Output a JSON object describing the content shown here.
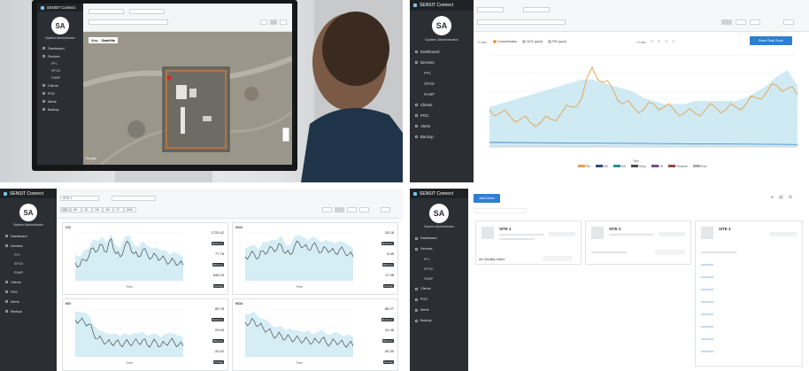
{
  "app": {
    "brand": "SENSIT Connect",
    "avatar": "SA",
    "role": "System Administrator"
  },
  "photo_screen": {
    "sidebar": [
      "Dashboard",
      "Devices",
      "PPL",
      "SPOD",
      "RAMP",
      "Clients",
      "POC",
      "Alerts",
      "Backup"
    ],
    "map_tabs": [
      "Map",
      "Satellite"
    ],
    "map_credit": "Google"
  },
  "detail_screen": {
    "sidebar": [
      "Dashboard",
      "Devices",
      "PPL",
      "SPOD",
      "RAMP",
      "Clients",
      "POC",
      "Alerts",
      "Backup"
    ],
    "y1_label": "Y1 axis",
    "legend_top": [
      "Concentration",
      "NO2 (ppm)",
      "PM (ppm)"
    ],
    "y2_label": "Y2 axis",
    "reset_button": "Reset Chart Zoom",
    "x_label": "Time",
    "legend_bottom": [
      "PM",
      "WD",
      "WS",
      "Temp",
      "RH",
      "Pressure",
      "Flow"
    ],
    "colors": {
      "concentration": "#e7a04a",
      "band": "#bfe3ef",
      "trace": "#2f7fd0"
    },
    "chart_data": {
      "type": "line",
      "x": [
        0,
        1,
        2,
        3,
        4,
        5,
        6,
        7,
        8,
        9,
        10,
        11,
        12,
        13,
        14,
        15,
        16,
        17,
        18,
        19,
        20,
        21,
        22,
        23,
        24,
        25,
        26,
        27,
        28,
        29,
        30
      ],
      "series": [
        {
          "values": [
            12,
            11,
            10,
            9,
            8,
            8,
            9,
            11,
            13,
            16,
            26,
            21,
            19,
            14,
            13,
            12,
            14,
            13,
            12,
            11,
            11,
            12,
            13,
            12,
            13,
            14,
            16,
            18,
            20,
            19,
            17
          ]
        },
        {
          "values": [
            13,
            14,
            15,
            16,
            17,
            18,
            19,
            20,
            21,
            22,
            22,
            21,
            20,
            19,
            18,
            16,
            15,
            14,
            14,
            14,
            15,
            15,
            15,
            15,
            15,
            16,
            18,
            20,
            23,
            25,
            20
          ]
        }
      ]
    }
  },
  "dashboard_screen": {
    "site_select": "SITE 1",
    "time_tabs": [
      "1H",
      "6H",
      "1D",
      "1W",
      "1M",
      "1Y",
      "MAX"
    ],
    "sidebar": [
      "Dashboard",
      "Devices",
      "PPL",
      "SPOD",
      "RAMP",
      "Clients",
      "POC",
      "Alerts",
      "Backup"
    ],
    "charts": [
      {
        "title": "CO",
        "xlabel": "Time",
        "stats": [
          {
            "value": "1720.42",
            "badge": "Maximum"
          },
          {
            "value": "77.78",
            "badge": "Minimum"
          },
          {
            "value": "645.29",
            "badge": "Average"
          }
        ],
        "chart_data": {
          "type": "line",
          "values": [
            30,
            25,
            35,
            40,
            55,
            50,
            60,
            48,
            70,
            45,
            40,
            58,
            62,
            45,
            40,
            52,
            44,
            38,
            42,
            36,
            35,
            30,
            33,
            28,
            26
          ]
        }
      },
      {
        "title": "SO2",
        "xlabel": "Time",
        "stats": [
          {
            "value": "28.18",
            "badge": "Maximum"
          },
          {
            "value": "5.99",
            "badge": "Minimum"
          },
          {
            "value": "17.08",
            "badge": "Average"
          }
        ],
        "chart_data": {
          "type": "line",
          "values": [
            40,
            42,
            45,
            38,
            50,
            48,
            55,
            52,
            60,
            46,
            44,
            58,
            63,
            57,
            52,
            60,
            55,
            48,
            54,
            50,
            46,
            52,
            49,
            44,
            40
          ]
        }
      },
      {
        "title": "NO",
        "xlabel": "Time",
        "stats": [
          {
            "value": "85.78",
            "badge": "Maximum"
          },
          {
            "value": "23.05",
            "badge": "Minimum"
          },
          {
            "value": "20.42",
            "badge": "Average"
          }
        ],
        "chart_data": {
          "type": "line",
          "values": [
            62,
            60,
            58,
            55,
            40,
            30,
            28,
            24,
            22,
            25,
            20,
            24,
            22,
            25,
            23,
            28,
            20,
            22,
            25,
            18,
            22,
            26,
            24,
            20,
            18
          ]
        }
      },
      {
        "title": "NO2",
        "xlabel": "Time",
        "stats": [
          {
            "value": "85.27",
            "badge": "Maximum"
          },
          {
            "value": "31.46",
            "badge": "Minimum"
          },
          {
            "value": "54.30",
            "badge": "Average"
          }
        ],
        "chart_data": {
          "type": "line",
          "values": [
            58,
            56,
            60,
            52,
            48,
            44,
            38,
            34,
            36,
            30,
            32,
            28,
            30,
            26,
            28,
            24,
            26,
            30,
            24,
            22,
            26,
            24,
            20,
            22,
            18
          ]
        }
      }
    ]
  },
  "clients_screen": {
    "sidebar": [
      "Dashboard",
      "Devices",
      "PPL",
      "SPOD",
      "RAMP",
      "Clients",
      "POC",
      "Alerts",
      "Backup"
    ],
    "add_button": "Add Device",
    "sites": [
      {
        "name": "SITE 1",
        "row_label": "Air Quality Index"
      },
      {
        "name": "SITE 2"
      },
      {
        "name": "SITE 3"
      }
    ]
  }
}
